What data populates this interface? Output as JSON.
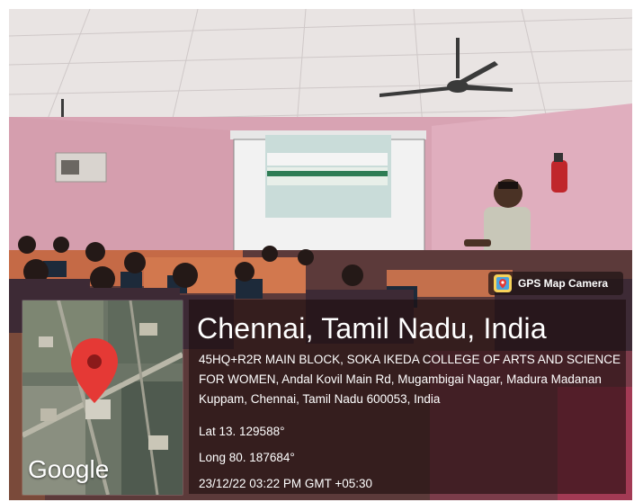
{
  "overlay": {
    "app_badge": "GPS Map Camera",
    "location_title": "Chennai,  Tamil Nadu,  India",
    "address": "45HQ+R2R MAIN BLOCK,  SOKA IKEDA COLLEGE OF ARTS AND SCIENCE FOR WOMEN,  Andal Kovil Main Rd,  Mugambigai Nagar, Madura Madanan Kuppam,  Chennai,  Tamil Nadu 600053,  India",
    "latitude": "Lat 13. 129588°",
    "longitude": "Long 80. 187684°",
    "timestamp": "23/12/22 03:22 PM GMT +05:30",
    "map_logo": "Google"
  },
  "colors": {
    "wall": "#d9a9b6",
    "overlay_bg": "#1e0c0c",
    "pin": "#e53935"
  },
  "icons": [
    "map-pin-icon",
    "gps-map-camera-icon"
  ]
}
